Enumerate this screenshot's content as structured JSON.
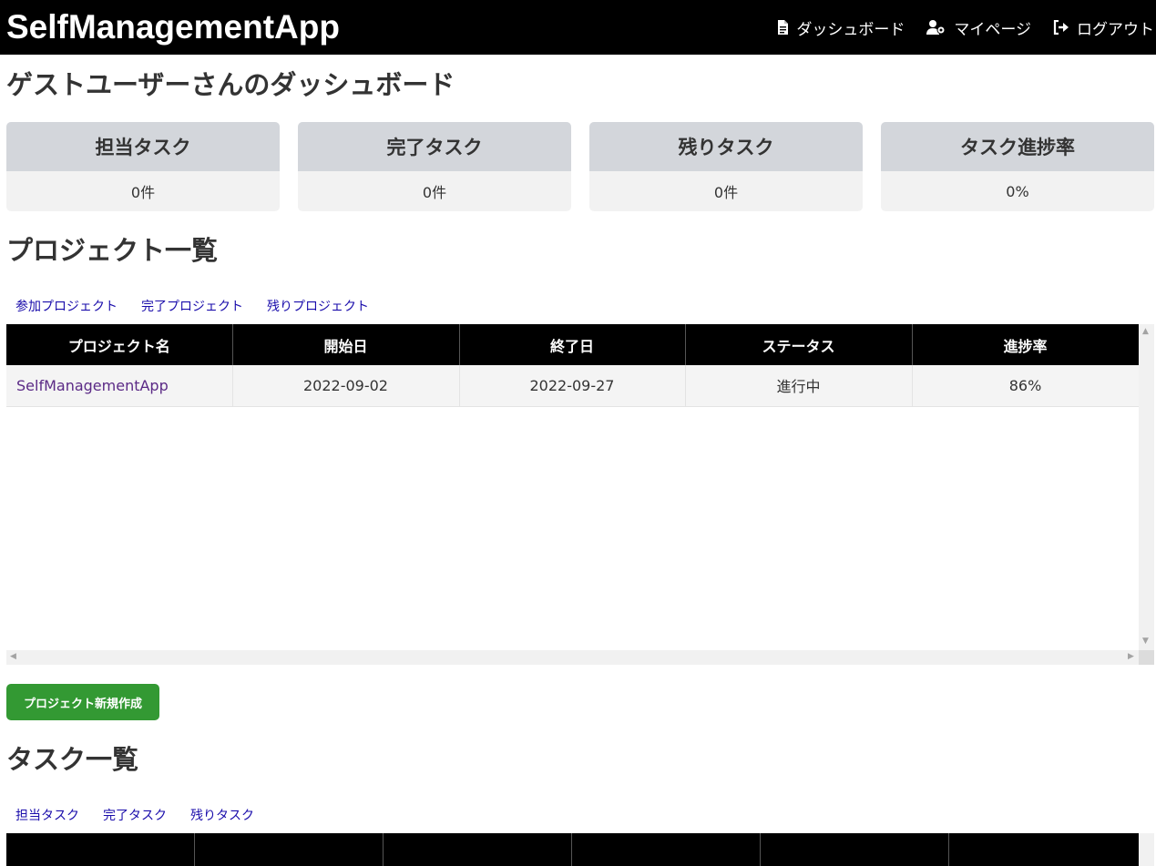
{
  "app": {
    "brand": "SelfManagementApp"
  },
  "nav": [
    {
      "label": "ダッシュボード",
      "icon": "document-icon"
    },
    {
      "label": "マイページ",
      "icon": "user-gear-icon"
    },
    {
      "label": "ログアウト",
      "icon": "logout-icon"
    }
  ],
  "page": {
    "title": "ゲストユーザーさんのダッシュボード"
  },
  "stats": [
    {
      "label": "担当タスク",
      "value": "0件"
    },
    {
      "label": "完了タスク",
      "value": "0件"
    },
    {
      "label": "残りタスク",
      "value": "0件"
    },
    {
      "label": "タスク進捗率",
      "value": "0%"
    }
  ],
  "projects": {
    "title": "プロジェクト一覧",
    "tabs": [
      "参加プロジェクト",
      "完了プロジェクト",
      "残りプロジェクト"
    ],
    "columns": [
      "プロジェクト名",
      "開始日",
      "終了日",
      "ステータス",
      "進捗率"
    ],
    "rows": [
      {
        "name": "SelfManagementApp",
        "start": "2022-09-02",
        "end": "2022-09-27",
        "status": "進行中",
        "progress": "86%"
      }
    ],
    "new_button": "プロジェクト新規作成"
  },
  "tasks": {
    "title": "タスク一覧",
    "tabs": [
      "担当タスク",
      "完了タスク",
      "残りタスク"
    ]
  },
  "colors": {
    "navbar": "#000000",
    "stat_header": "#d3d6db",
    "button_green": "#339933",
    "link_blue": "#1a0dab",
    "project_link": "#5b2a86"
  }
}
